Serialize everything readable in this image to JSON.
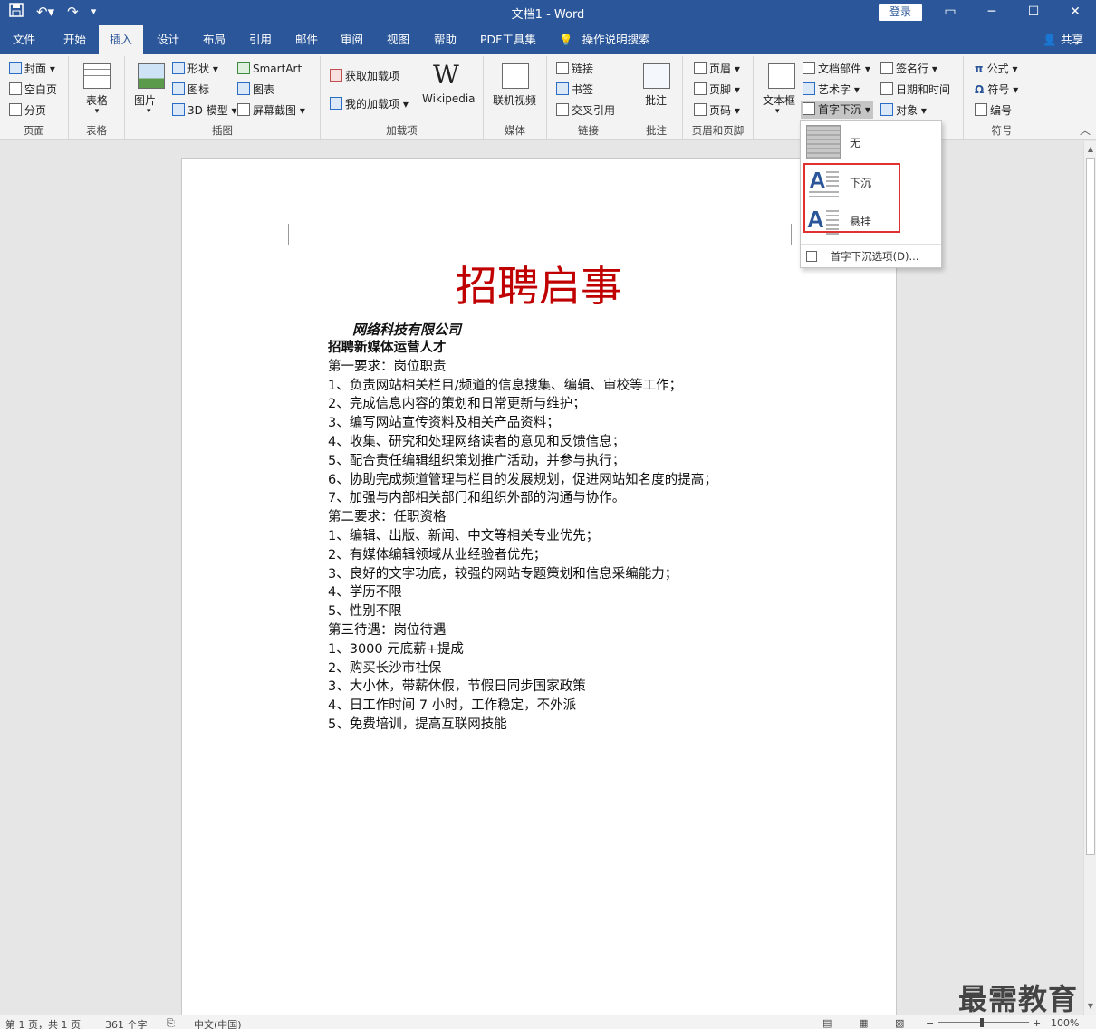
{
  "window": {
    "title": "文档1 - Word",
    "login": "登录",
    "share": "共享"
  },
  "qat": {
    "save": "save-icon",
    "undo": "undo-icon",
    "redo": "redo-icon"
  },
  "tabs": [
    "文件",
    "开始",
    "插入",
    "设计",
    "布局",
    "引用",
    "邮件",
    "审阅",
    "视图",
    "帮助",
    "PDF工具集",
    "操作说明搜索"
  ],
  "active_tab": "插入",
  "ribbon": {
    "page_group": {
      "label": "页面",
      "items": [
        "封面",
        "空白页",
        "分页"
      ]
    },
    "table_group": {
      "label": "表格",
      "item": "表格"
    },
    "illus_group": {
      "label": "插图",
      "picture": "图片",
      "shapes": "形状",
      "icons": "图标",
      "model3d": "3D 模型",
      "smartart": "SmartArt",
      "chart": "图表",
      "screenshot": "屏幕截图"
    },
    "addins_group": {
      "label": "加载项",
      "get": "获取加载项",
      "mine": "我的加载项",
      "wikipedia": "Wikipedia"
    },
    "media_group": {
      "label": "媒体",
      "video": "联机视频"
    },
    "links_group": {
      "label": "链接",
      "link": "链接",
      "bookmark": "书签",
      "crossref": "交叉引用"
    },
    "comment_group": {
      "label": "批注",
      "comment": "批注"
    },
    "hf_group": {
      "label": "页眉和页脚",
      "header": "页眉",
      "footer": "页脚",
      "pagenum": "页码"
    },
    "text_group": {
      "textbox": "文本框",
      "quickparts": "文档部件",
      "wordart": "艺术字",
      "dropcap": "首字下沉",
      "signature": "签名行",
      "datetime": "日期和时间",
      "object": "对象"
    },
    "symbol_group": {
      "label": "符号",
      "equation": "公式",
      "symbol": "符号",
      "number": "编号"
    }
  },
  "dropdown": {
    "items": [
      "无",
      "下沉",
      "悬挂"
    ],
    "options": "首字下沉选项(D)..."
  },
  "document": {
    "title": "招聘启事",
    "company": "网络科技有限公司",
    "lines": [
      {
        "text": "招聘新媒体运营人才",
        "bold": true
      },
      {
        "text": "第一要求：岗位职责",
        "bold": false
      },
      {
        "text": "1、负责网站相关栏目/频道的信息搜集、编辑、审校等工作；",
        "bold": false
      },
      {
        "text": "2、完成信息内容的策划和日常更新与维护；",
        "bold": false
      },
      {
        "text": "3、编写网站宣传资料及相关产品资料；",
        "bold": false
      },
      {
        "text": "4、收集、研究和处理网络读者的意见和反馈信息；",
        "bold": false
      },
      {
        "text": "5、配合责任编辑组织策划推广活动，并参与执行；",
        "bold": false
      },
      {
        "text": "6、协助完成频道管理与栏目的发展规划，促进网站知名度的提高；",
        "bold": false
      },
      {
        "text": "7、加强与内部相关部门和组织外部的沟通与协作。",
        "bold": false
      },
      {
        "text": "第二要求：任职资格",
        "bold": false
      },
      {
        "text": "1、编辑、出版、新闻、中文等相关专业优先；",
        "bold": false
      },
      {
        "text": "2、有媒体编辑领域从业经验者优先；",
        "bold": false
      },
      {
        "text": "3、良好的文字功底，较强的网站专题策划和信息采编能力；",
        "bold": false
      },
      {
        "text": "4、学历不限",
        "bold": false
      },
      {
        "text": "5、性别不限",
        "bold": false
      },
      {
        "text": "第三待遇：岗位待遇",
        "bold": false
      },
      {
        "text": "1、3000 元底薪+提成",
        "bold": false
      },
      {
        "text": "2、购买长沙市社保",
        "bold": false
      },
      {
        "text": "3、大小休，带薪休假，节假日同步国家政策",
        "bold": false
      },
      {
        "text": "4、日工作时间 7 小时，工作稳定，不外派",
        "bold": false
      },
      {
        "text": "5、免费培训，提高互联网技能",
        "bold": false
      }
    ]
  },
  "status": {
    "page": "第 1 页，共 1 页",
    "words": "361 个字",
    "lang": "中文(中国)",
    "zoom": "100%"
  },
  "watermark": "最需教育",
  "colors": {
    "accent": "#2b579a",
    "title_red": "#c00000",
    "highlight": "#e03030"
  }
}
